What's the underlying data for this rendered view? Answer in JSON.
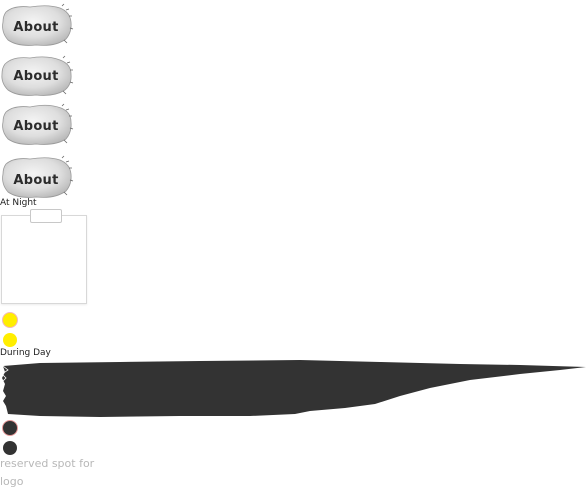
{
  "nav": {
    "buttons": [
      {
        "label": "About"
      },
      {
        "label": "About"
      },
      {
        "label": "About"
      },
      {
        "label": "About"
      }
    ]
  },
  "mode": {
    "night_label": "At Night",
    "day_label": "During Day"
  },
  "colors": {
    "sun": "#ffee00",
    "moon": "#333333",
    "brush": "#333333"
  },
  "logo": {
    "placeholder": "reserved spot for logo"
  }
}
